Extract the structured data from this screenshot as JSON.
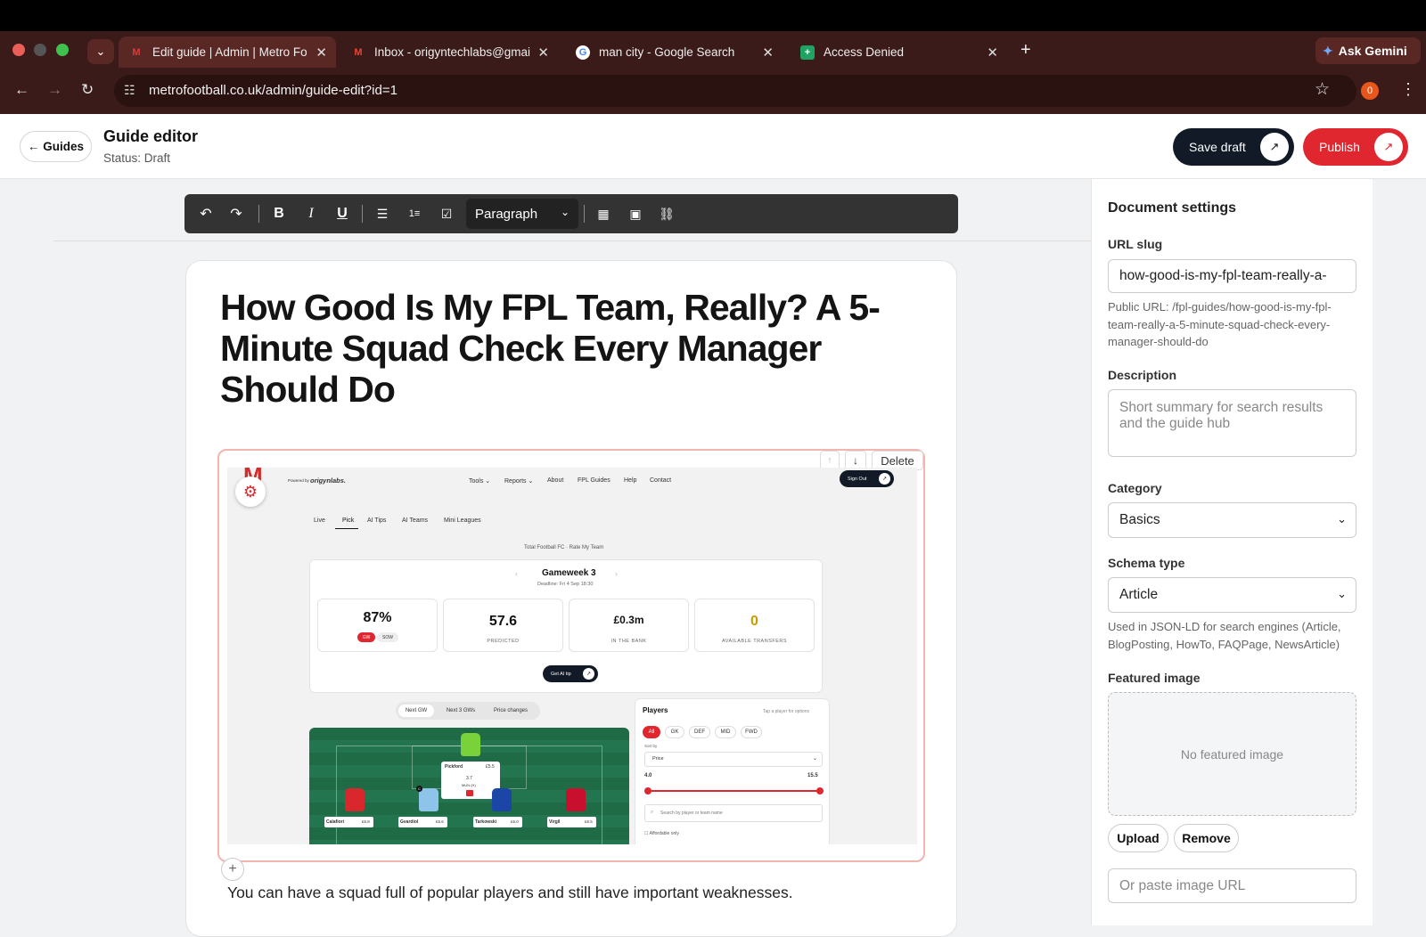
{
  "browser": {
    "tabs": [
      {
        "title": "Edit guide | Admin | Metro Fo",
        "icon": "metro-logo-icon"
      },
      {
        "title": "Inbox - origyntechlabs@gmai",
        "icon": "gmail-icon"
      },
      {
        "title": "man city - Google Search",
        "icon": "google-icon"
      },
      {
        "title": "Access Denied",
        "icon": "sheets-icon"
      }
    ],
    "url": "metrofootball.co.uk/admin/guide-edit?id=1",
    "gemini_label": "Ask Gemini",
    "extension_badge": "0"
  },
  "header": {
    "back_label": "← Guides",
    "title": "Guide editor",
    "status": "Status: Draft",
    "save_draft_label": "Save draft",
    "publish_label": "Publish"
  },
  "toolbar": {
    "block_format": "Paragraph"
  },
  "editor": {
    "title": "How Good Is My FPL Team, Really? A 5-Minute Squad Check Every Manager Should Do",
    "delete_label": "Delete",
    "paragraph": "You can have a squad full of popular players and still have important weaknesses."
  },
  "embedded_screenshot": {
    "powered_by": "Powered by",
    "brand": "origynlabs.",
    "nav": [
      "Tools ⌄",
      "Reports ⌄",
      "About",
      "FPL Guides",
      "Help",
      "Contact"
    ],
    "sign_out": "Sign Out",
    "subtabs": [
      "Live",
      "Pick",
      "AI Tips",
      "AI Teams",
      "Mini Leagues"
    ],
    "team_line": "Total Football FC · Rate My Team",
    "gameweek": "Gameweek 3",
    "deadline": "Deadline: Fri 4 Sep 18:30",
    "stats": [
      {
        "value": "87%",
        "label": ""
      },
      {
        "value": "57.6",
        "label": "PREDICTED"
      },
      {
        "value": "£0.3m",
        "label": "IN THE BANK"
      },
      {
        "value": "0",
        "label": "AVAILABLE TRANSFERS"
      }
    ],
    "gw_chip": "GW",
    "sow_chip": "SOW",
    "ai_tip": "Get AI tip",
    "pitch_tabs": [
      "Next GW",
      "Next 3 GWs",
      "Price changes"
    ],
    "players_title": "Players",
    "players_hint": "Tap a player for options",
    "positions": [
      "All",
      "GK",
      "DEF",
      "MID",
      "FWD"
    ],
    "sort_label": "Sort by",
    "sort_value": "Price",
    "range_min": "4.0",
    "range_max": "15.5",
    "search_placeholder": "Search by player or team name",
    "affordable": "Affordable only",
    "gk_card": {
      "name": "Pickford",
      "price": "£5.5",
      "pts": "3.7",
      "fixture": "MUN (H)"
    },
    "defenders": [
      {
        "name": "Calafiori",
        "price": "£5.8"
      },
      {
        "name": "Gvardiol",
        "price": "£5.6"
      },
      {
        "name": "Tarkowski",
        "price": "£6.0"
      },
      {
        "name": "Virgil",
        "price": "£6.5"
      }
    ]
  },
  "sidebar": {
    "title": "Document settings",
    "url_slug_label": "URL slug",
    "url_slug_value": "how-good-is-my-fpl-team-really-a-",
    "public_url": "Public URL: /fpl-guides/how-good-is-my-fpl-team-really-a-5-minute-squad-check-every-manager-should-do",
    "description_label": "Description",
    "description_placeholder": "Short summary for search results and the guide hub",
    "category_label": "Category",
    "category_value": "Basics",
    "schema_label": "Schema type",
    "schema_value": "Article",
    "schema_help": "Used in JSON-LD for search engines (Article, BlogPosting, HowTo, FAQPage, NewsArticle)",
    "featured_label": "Featured image",
    "no_featured": "No featured image",
    "upload_label": "Upload",
    "remove_label": "Remove",
    "image_url_placeholder": "Or paste image URL"
  }
}
